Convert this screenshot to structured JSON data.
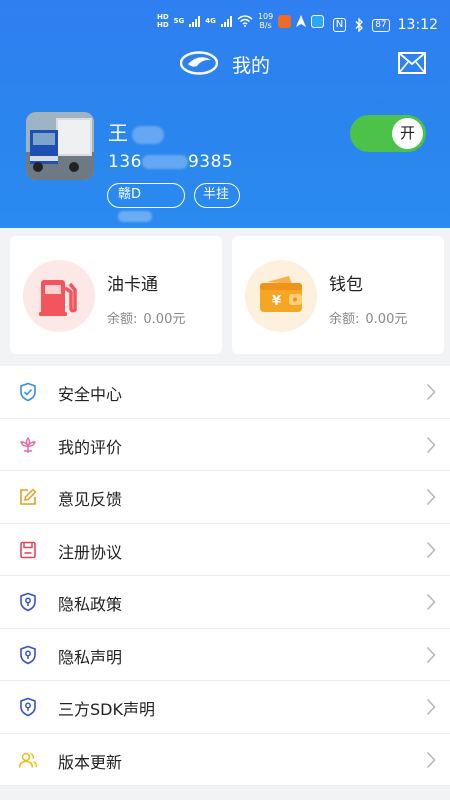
{
  "status_bar": {
    "hd1": "HD",
    "hd2": "HD",
    "net_speed_value": "109",
    "net_speed_unit": "B/s",
    "signal1_label": "5G",
    "signal2_label": "4G",
    "nfc": "N",
    "battery": "87",
    "time": "13:12"
  },
  "nav": {
    "title": "我的",
    "logo_icon": "brand-logo-icon",
    "mail_icon": "mail-icon"
  },
  "user": {
    "name_visible": "王",
    "phone_prefix": "136",
    "phone_suffix": "9385",
    "plate_prefix": "赣D",
    "trailer_tag": "半挂",
    "toggle_label": "开",
    "toggle_on": true
  },
  "cards": [
    {
      "title": "油卡通",
      "balance_label": "余额:",
      "balance_value": "0.00元",
      "icon": "fuel-pump-icon",
      "accent": "#f2555c"
    },
    {
      "title": "钱包",
      "balance_label": "余额:",
      "balance_value": "0.00元",
      "icon": "wallet-icon",
      "accent": "#f5a623"
    }
  ],
  "menu": [
    {
      "label": "安全中心",
      "icon": "shield-check-icon",
      "color": "#3a8ee6"
    },
    {
      "label": "我的评价",
      "icon": "flower-icon",
      "color": "#e46aa2"
    },
    {
      "label": "意见反馈",
      "icon": "edit-icon",
      "color": "#e0a020"
    },
    {
      "label": "注册协议",
      "icon": "save-document-icon",
      "color": "#e0465a"
    },
    {
      "label": "隐私政策",
      "icon": "shield-key-icon",
      "color": "#3b55c9"
    },
    {
      "label": "隐私声明",
      "icon": "shield-key-icon",
      "color": "#3b55c9"
    },
    {
      "label": "三方SDK声明",
      "icon": "shield-key-icon",
      "color": "#3b55c9"
    },
    {
      "label": "版本更新",
      "icon": "users-icon",
      "color": "#e8c21c"
    }
  ],
  "colors": {
    "header_blue": "#2f82ef",
    "toggle_green": "#4cc24a"
  }
}
